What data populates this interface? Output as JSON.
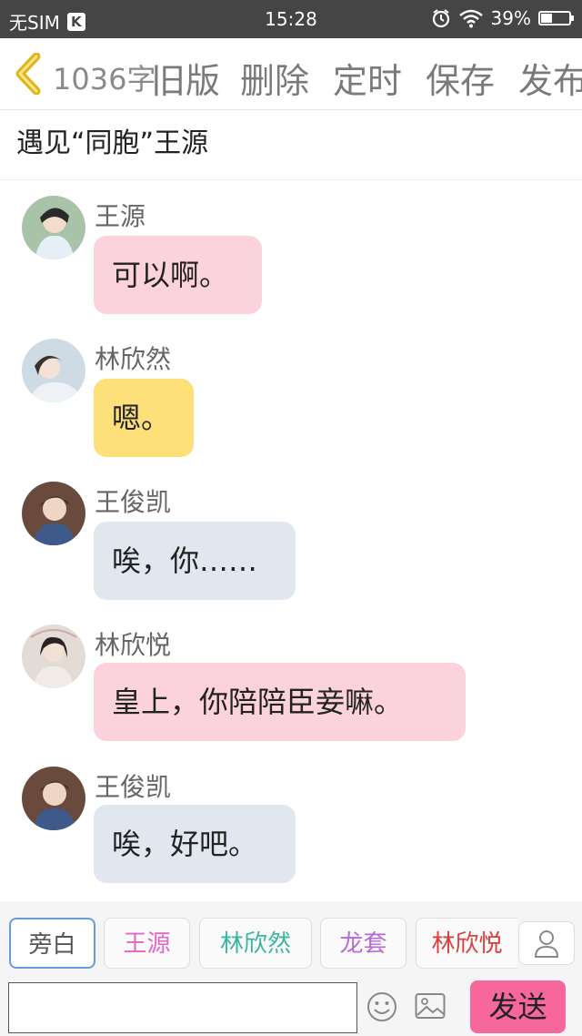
{
  "status_bar": {
    "carrier": "无SIM",
    "app_badge": "K",
    "time": "15:28",
    "battery_text": "39%",
    "battery_level": 0.39,
    "icons": [
      "alarm-icon",
      "wifi-icon",
      "battery-icon"
    ]
  },
  "toolbar": {
    "word_count": "1036字",
    "buttons": [
      "旧版",
      "删除",
      "定时",
      "保存",
      "发布"
    ]
  },
  "story": {
    "title": "遇见“同胞”王源"
  },
  "messages": [
    {
      "speaker": "王源",
      "text": "可以啊。",
      "bubble_color": "#fcd2dc",
      "avatar_color": "#9fb8a0"
    },
    {
      "speaker": "林欣然",
      "text": "嗯。",
      "bubble_color": "#fde07a",
      "avatar_color": "#c9d7e2"
    },
    {
      "speaker": "王俊凯",
      "text": "唉，你……",
      "bubble_color": "#e0e7ef",
      "avatar_color": "#3b4a66"
    },
    {
      "speaker": "林欣悦",
      "text": "皇上，你陪陪臣妾嘛。",
      "bubble_color": "#fcd2dc",
      "avatar_color": "#dcd3cc"
    },
    {
      "speaker": "王俊凯",
      "text": "唉，好吧。",
      "bubble_color": "#e0e7ef",
      "avatar_color": "#3b4a66"
    }
  ],
  "roles": [
    {
      "label": "旁白",
      "color": "#555555"
    },
    {
      "label": "王源",
      "color": "#e066c8"
    },
    {
      "label": "林欣然",
      "color": "#3ab5a0"
    },
    {
      "label": "龙套",
      "color": "#b56ad8"
    },
    {
      "label": "林欣悦",
      "color": "#d84040"
    }
  ],
  "input": {
    "send_label": "发送",
    "send_color": "#f7679c"
  }
}
